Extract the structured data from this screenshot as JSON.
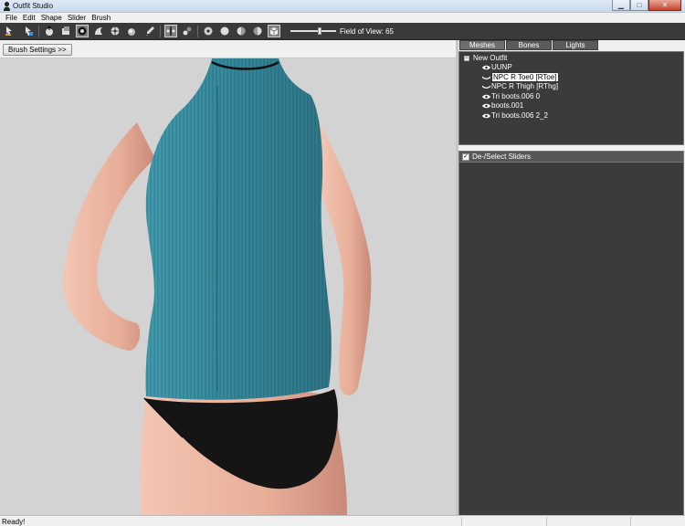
{
  "window": {
    "title": "Outfit Studio"
  },
  "menu": [
    "File",
    "Edit",
    "Shape",
    "Slider",
    "Brush"
  ],
  "toolbar": {
    "icons": [
      "select-tool-icon",
      "transform-tool-icon",
      "inflate-brush-icon",
      "deflate-brush-icon",
      "move-brush-icon",
      "smooth-brush-icon",
      "weight-paint-icon",
      "mask-brush-icon",
      "color-brush-icon",
      "pick-icon",
      "mirror-icon",
      "vertex-mode-icon",
      "sphere-view-icon",
      "front-view-icon",
      "side-view-icon",
      "back-view-icon",
      "perspective-icon"
    ],
    "fov_label": "Field of View: 65",
    "fov_value": 65,
    "fov_max": 100
  },
  "viewport": {
    "brush_settings_label": "Brush Settings >>"
  },
  "tabs": [
    {
      "label": "Meshes",
      "active": true
    },
    {
      "label": "Bones",
      "active": false
    },
    {
      "label": "Lights",
      "active": false
    }
  ],
  "mesh_tree": {
    "root_label": "New Outfit",
    "root_expand": "−",
    "items": [
      {
        "label": "UUNP",
        "visibility": "visible",
        "selected": false
      },
      {
        "label": "NPC R Toe0 [RToe]",
        "visibility": "hidden",
        "selected": true
      },
      {
        "label": "NPC R Thigh [RThg]",
        "visibility": "hidden",
        "selected": false
      },
      {
        "label": "Tri boots.006 0",
        "visibility": "visible",
        "selected": false
      },
      {
        "label": "boots.001",
        "visibility": "visible",
        "selected": false
      },
      {
        "label": "Tri boots.006 2_2",
        "visibility": "visible",
        "selected": false
      }
    ]
  },
  "sliders": {
    "header_label": "De-/Select Sliders",
    "checked": true,
    "check_mark": "✓"
  },
  "status": {
    "text": "Ready!"
  },
  "colors": {
    "toolbar_bg": "#3a3a3a",
    "panel_bg": "#3b3b3b",
    "viewport_bg": "#d3d3d3",
    "top_color": "#3f8ea0",
    "bottom_color": "#151515",
    "skin": "#e9b7a3"
  }
}
